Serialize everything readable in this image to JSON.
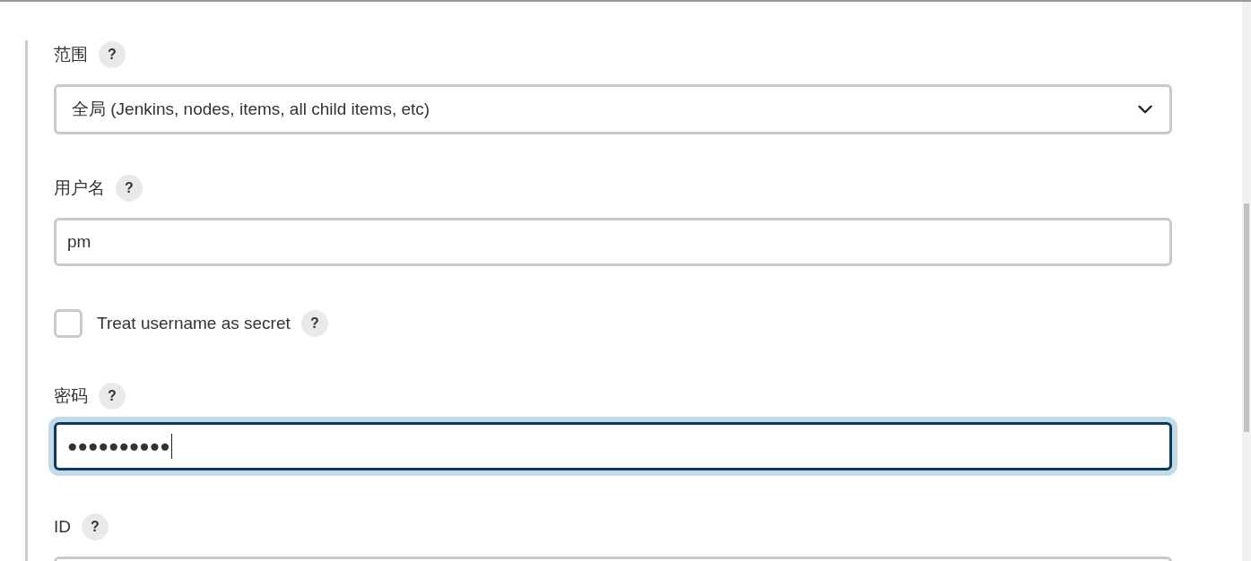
{
  "fields": [
    {
      "kind": "select",
      "label": "范围",
      "help": "?",
      "value": "全局 (Jenkins, nodes, items, all child items, etc)"
    },
    {
      "kind": "text",
      "label": "用户名",
      "help": "?",
      "value": "pm",
      "focused": false
    },
    {
      "kind": "checkbox",
      "label": "Treat username as secret",
      "help": "?",
      "checked": false
    },
    {
      "kind": "password",
      "label": "密码",
      "help": "?",
      "value": "●●●●●●●●●●",
      "focused": true
    },
    {
      "kind": "text",
      "label": "ID",
      "help": "?",
      "focused": false
    }
  ]
}
